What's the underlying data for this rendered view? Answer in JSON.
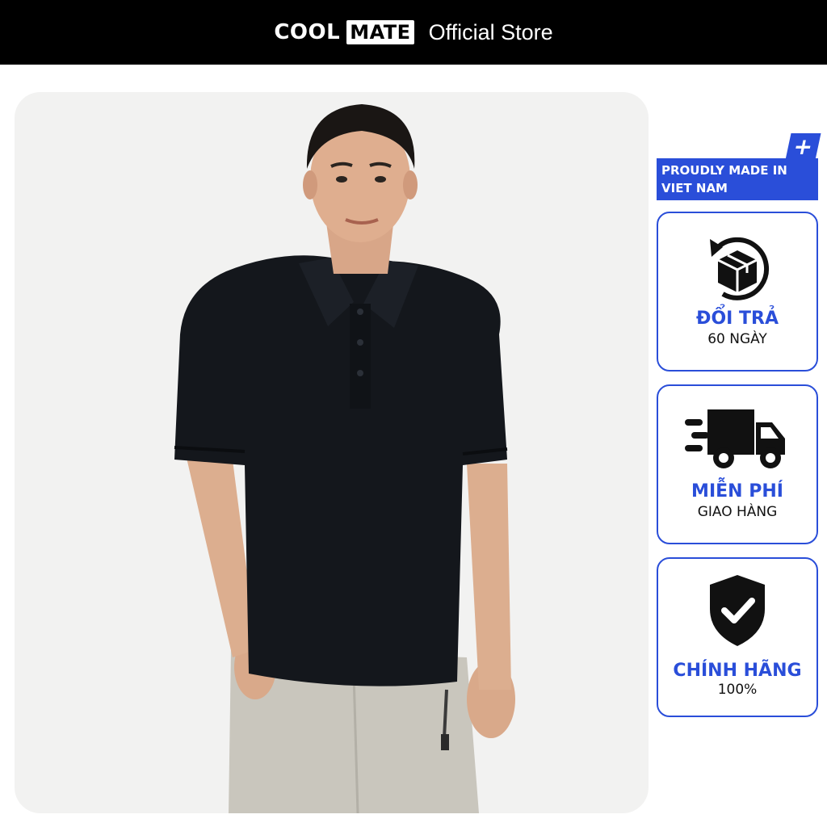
{
  "header": {
    "logo_cool": "COOL",
    "logo_mate": "MATE",
    "store_label": "Official Store"
  },
  "product_photo": {
    "description": "man-wearing-black-polo-shirt"
  },
  "made_in": {
    "text": "PROUDLY MADE IN VIET NAM",
    "icon": "plus-icon"
  },
  "badges": [
    {
      "icon": "return-box-icon",
      "title": "ĐỔI TRẢ",
      "subtitle": "60 NGÀY"
    },
    {
      "icon": "delivery-truck-icon",
      "title": "MIỄN PHÍ",
      "subtitle": "GIAO HÀNG"
    },
    {
      "icon": "shield-check-icon",
      "title": "CHÍNH HÃNG",
      "subtitle": "100%"
    }
  ],
  "colors": {
    "accent": "#2a4ed9",
    "header_bg": "#000000",
    "card_bg": "#f2f2f1"
  }
}
